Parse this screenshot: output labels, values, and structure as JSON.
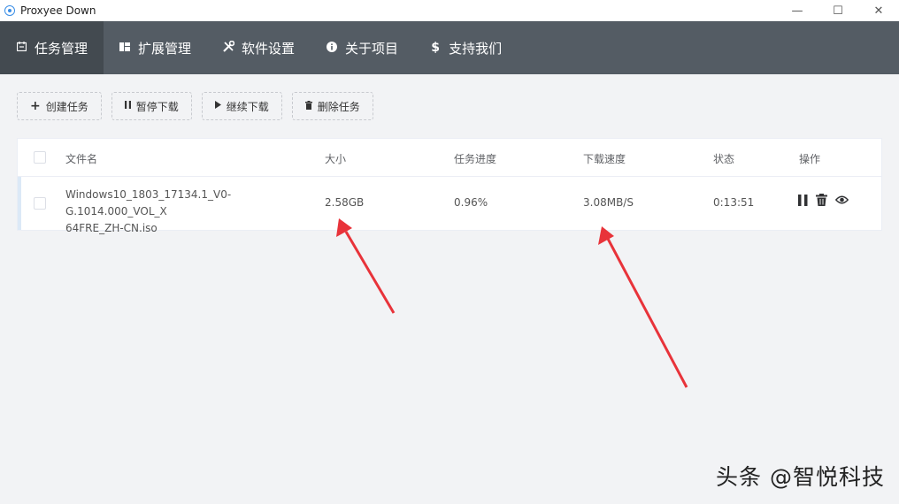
{
  "window": {
    "title": "Proxyee Down",
    "controls": [
      "—",
      "☐",
      "✕"
    ]
  },
  "nav": [
    {
      "label": "任务管理",
      "icon": "task-icon",
      "active": true
    },
    {
      "label": "扩展管理",
      "icon": "puzzle-icon",
      "active": false
    },
    {
      "label": "软件设置",
      "icon": "tools-icon",
      "active": false
    },
    {
      "label": "关于项目",
      "icon": "info-icon",
      "active": false
    },
    {
      "label": "支持我们",
      "icon": "dollar-icon",
      "active": false
    }
  ],
  "toolbar": {
    "create": "创建任务",
    "pause": "暂停下载",
    "resume": "继续下载",
    "delete": "删除任务"
  },
  "table": {
    "headers": {
      "filename": "文件名",
      "size": "大小",
      "progress": "任务进度",
      "speed": "下载速度",
      "status": "状态",
      "actions": "操作"
    },
    "rows": [
      {
        "filename_line1": "Windows10_1803_17134.1_V0-G.1014.000_VOL_X",
        "filename_line2": "64FRE_ZH-CN.iso",
        "size": "2.58GB",
        "progress": "0.96%",
        "speed": "3.08MB/S",
        "status": "0:13:51"
      }
    ]
  },
  "watermark": "头条 @智悦科技",
  "colors": {
    "nav_bg": "#545c64",
    "nav_active": "#434a50",
    "annotation_red": "#e8333a"
  }
}
